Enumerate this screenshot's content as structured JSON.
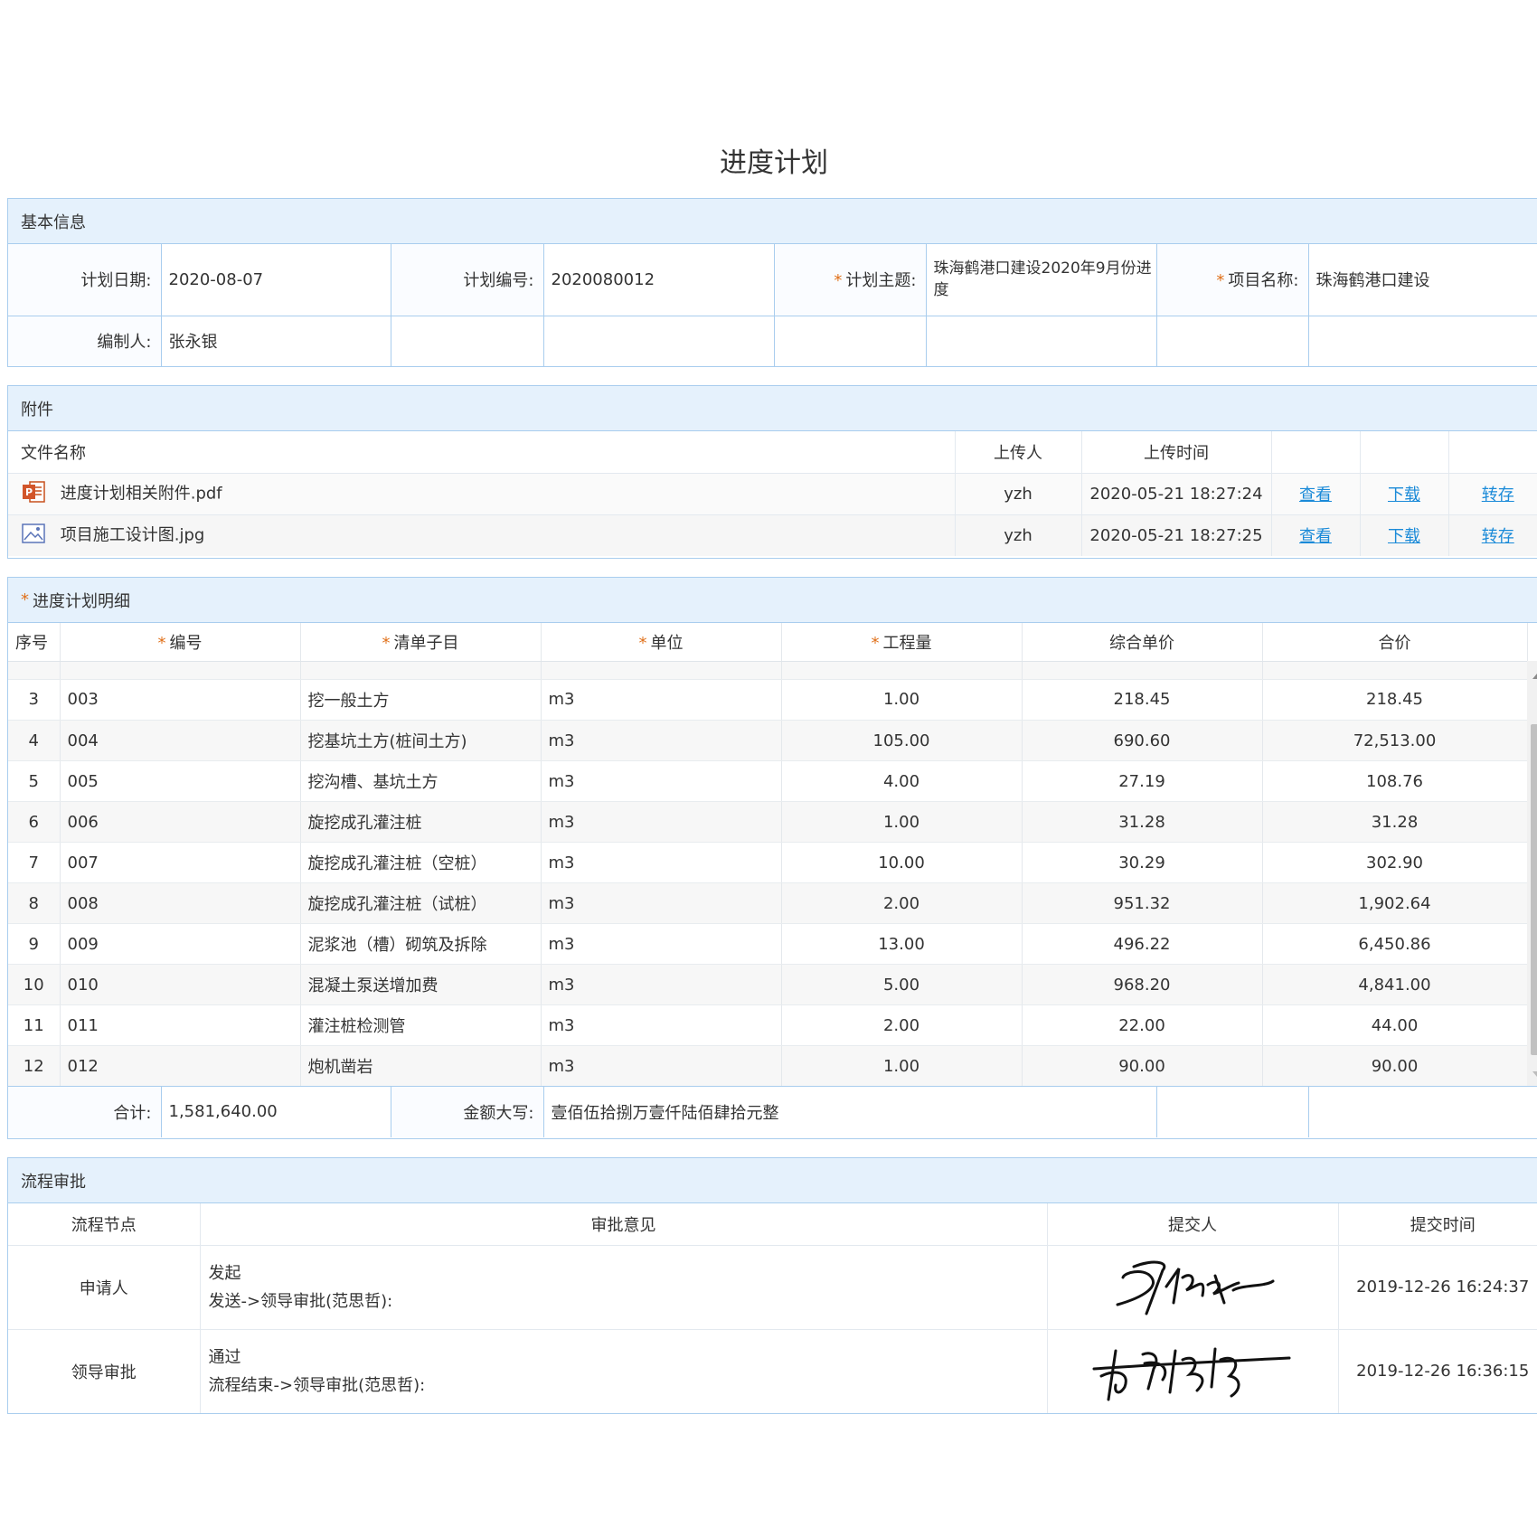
{
  "page": {
    "title": "进度计划"
  },
  "basic_info": {
    "section_title": "基本信息",
    "plan_date_label": "计划日期:",
    "plan_date": "2020-08-07",
    "plan_no_label": "计划编号:",
    "plan_no": "2020080012",
    "plan_subject_label": "计划主题:",
    "plan_subject": "珠海鹤港口建设2020年9月份进度",
    "project_name_label": "项目名称:",
    "project_name": "珠海鹤港口建设",
    "editor_label": "编制人:",
    "editor": "张永银"
  },
  "attachments": {
    "section_title": "附件",
    "headers": {
      "file_name": "文件名称",
      "uploader": "上传人",
      "upload_time": "上传时间"
    },
    "items": [
      {
        "icon": "ppt-file-icon",
        "name": "进度计划相关附件.pdf",
        "uploader": "yzh",
        "time": "2020-05-21 18:27:24",
        "view": "查看",
        "download": "下载",
        "save": "转存"
      },
      {
        "icon": "image-file-icon",
        "name": "项目施工设计图.jpg",
        "uploader": "yzh",
        "time": "2020-05-21 18:27:25",
        "view": "查看",
        "download": "下载",
        "save": "转存"
      }
    ]
  },
  "detail": {
    "section_title": "进度计划明细",
    "headers": {
      "seq": "序号",
      "code": "编号",
      "item": "清单子目",
      "unit": "单位",
      "quantity": "工程量",
      "unit_price": "综合单价",
      "total": "合价"
    },
    "rows": [
      {
        "seq": "3",
        "code": "003",
        "item": "挖一般土方",
        "unit": "m3",
        "quantity": "1.00",
        "unit_price": "218.45",
        "total": "218.45"
      },
      {
        "seq": "4",
        "code": "004",
        "item": "挖基坑土方(桩间土方)",
        "unit": "m3",
        "quantity": "105.00",
        "unit_price": "690.60",
        "total": "72,513.00"
      },
      {
        "seq": "5",
        "code": "005",
        "item": "挖沟槽、基坑土方",
        "unit": "m3",
        "quantity": "4.00",
        "unit_price": "27.19",
        "total": "108.76"
      },
      {
        "seq": "6",
        "code": "006",
        "item": "旋挖成孔灌注桩",
        "unit": "m3",
        "quantity": "1.00",
        "unit_price": "31.28",
        "total": "31.28"
      },
      {
        "seq": "7",
        "code": "007",
        "item": "旋挖成孔灌注桩（空桩）",
        "unit": "m3",
        "quantity": "10.00",
        "unit_price": "30.29",
        "total": "302.90"
      },
      {
        "seq": "8",
        "code": "008",
        "item": "旋挖成孔灌注桩（试桩）",
        "unit": "m3",
        "quantity": "2.00",
        "unit_price": "951.32",
        "total": "1,902.64"
      },
      {
        "seq": "9",
        "code": "009",
        "item": "泥浆池（槽）砌筑及拆除",
        "unit": "m3",
        "quantity": "13.00",
        "unit_price": "496.22",
        "total": "6,450.86"
      },
      {
        "seq": "10",
        "code": "010",
        "item": "混凝土泵送增加费",
        "unit": "m3",
        "quantity": "5.00",
        "unit_price": "968.20",
        "total": "4,841.00"
      },
      {
        "seq": "11",
        "code": "011",
        "item": "灌注桩检测管",
        "unit": "m3",
        "quantity": "2.00",
        "unit_price": "22.00",
        "total": "44.00"
      },
      {
        "seq": "12",
        "code": "012",
        "item": "炮机凿岩",
        "unit": "m3",
        "quantity": "1.00",
        "unit_price": "90.00",
        "total": "90.00"
      }
    ],
    "total_label": "合计:",
    "total": "1,581,640.00",
    "amount_words_label": "金额大写:",
    "amount_words": "壹佰伍拾捌万壹仟陆佰肆拾元整"
  },
  "approval": {
    "section_title": "流程审批",
    "headers": {
      "node": "流程节点",
      "opinion": "审批意见",
      "submitter": "提交人",
      "time": "提交时间"
    },
    "rows": [
      {
        "node": "申请人",
        "opinion_line1": "发起",
        "opinion_line2": "发送->领导审批(范思哲):",
        "time": "2019-12-26 16:24:37"
      },
      {
        "node": "领导审批",
        "opinion_line1": "通过",
        "opinion_line2": "流程结束->领导审批(范思哲):",
        "time": "2019-12-26 16:36:15"
      }
    ]
  },
  "colors": {
    "border": "#a9cdee",
    "header_bg": "#e5f1fc",
    "link": "#1a8ad8",
    "required": "#e0701a"
  }
}
